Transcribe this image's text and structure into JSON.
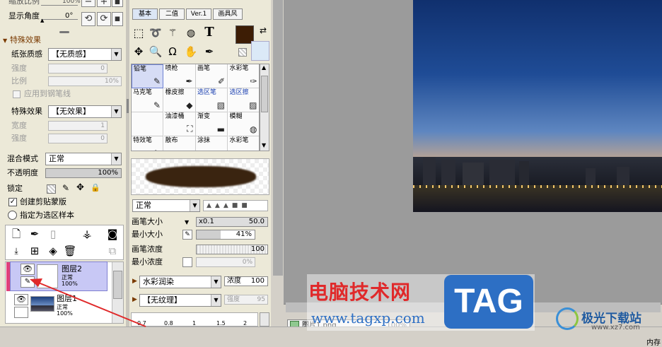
{
  "left_panel": {
    "zoom_label": "缩放比例",
    "zoom_value": "100%",
    "angle_label": "显示角度",
    "angle_value": "0°",
    "special_header": "特殊效果",
    "paper_texture_label": "纸张质感",
    "paper_texture_value": "【无质感】",
    "strength_label": "强度",
    "strength_value": "0",
    "ratio_label": "比例",
    "ratio_value": "10%",
    "apply_pen_label": "应用到钢笔线",
    "special_effect_label": "特殊效果",
    "special_effect_value": "【无效果】",
    "width_label": "宽度",
    "width_value": "1",
    "strength2_label": "强度",
    "strength2_value": "0",
    "blend_label": "混合模式",
    "blend_value": "正常",
    "opacity_label": "不透明度",
    "opacity_value": "100%",
    "opacity_fraction": 1.0,
    "lock_label": "锁定",
    "clip_label": "创建剪贴蒙版",
    "clip_checked": true,
    "selection_source_label": "指定为选区样本",
    "layers": [
      {
        "name": "图层2",
        "mode": "正常",
        "opacity": "100%",
        "selected": true
      },
      {
        "name": "图层1",
        "mode": "正常",
        "opacity": "100%",
        "selected": false
      }
    ]
  },
  "mid_panel": {
    "tabs": [
      "基本",
      "二值",
      "Ver.1",
      "画具风"
    ],
    "brushes": [
      {
        "name": "铅笔",
        "icon": "✎"
      },
      {
        "name": "喷枪",
        "icon": "✒"
      },
      {
        "name": "画笔",
        "icon": "✐"
      },
      {
        "name": "水彩笔",
        "icon": "✑"
      },
      {
        "name": "马克笔",
        "icon": "✎"
      },
      {
        "name": "橡皮擦",
        "icon": "◆"
      },
      {
        "name": "选区笔",
        "icon": "▧"
      },
      {
        "name": "选区擦",
        "icon": "▨"
      },
      {
        "name": "",
        "icon": ""
      },
      {
        "name": "油漆桶",
        "icon": "⛶"
      },
      {
        "name": "渐变",
        "icon": "▬"
      },
      {
        "name": "模糊",
        "icon": "◍"
      },
      {
        "name": "特效笔",
        "icon": "✎"
      },
      {
        "name": "散布",
        "icon": "∴"
      },
      {
        "name": "涂抹",
        "icon": "〜"
      },
      {
        "name": "水彩笔",
        "icon": "✑"
      }
    ],
    "brush_mode": "正常",
    "brush_size_label": "画笔大小",
    "brush_size_mult": "x0.1",
    "brush_size_value": "50.0",
    "min_size_label": "最小大小",
    "min_size_value": "41%",
    "min_size_fraction": 0.41,
    "density_label": "画笔浓度",
    "density_value": "100",
    "min_density_label": "最小浓度",
    "min_density_value": "0%",
    "blend_tool": "水彩润染",
    "blend_tool_sub": "浓度",
    "blend_tool_sub_value": "100",
    "texture_value": "【无纹理】",
    "texture_sub": "强度",
    "texture_sub_value": "95",
    "size_row": [
      "0.7",
      "0.8",
      "1",
      "1.5",
      "2"
    ]
  },
  "canvas": {
    "tab_label": "图片1.png",
    "tab_zoom": "100%",
    "corner_text": "内存"
  },
  "watermarks": {
    "site_cn": "电脑技术网",
    "site_url": "www.tagxp.com",
    "tag": "TAG",
    "right_brand": "极光下载站",
    "right_url": "www.xz7.com"
  },
  "colors": {
    "primary_color": "#3d1d05",
    "secondary_color": "#dbe9f7",
    "accent_red": "#e0292a",
    "tag_blue": "#2d6fc4",
    "selected_layer": "#c8c8f5"
  }
}
